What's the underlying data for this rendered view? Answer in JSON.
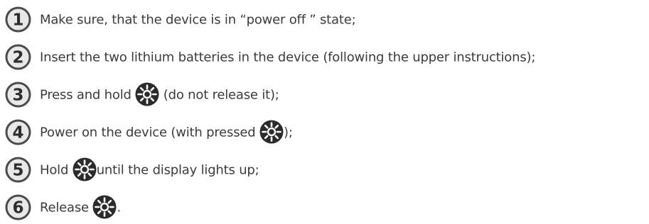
{
  "steps": [
    {
      "number": "1",
      "parts": [
        "Make sure, that the device is in “power off ” state;"
      ]
    },
    {
      "number": "2",
      "parts": [
        "Insert the two lithium batteries in the device (following the upper instructions);"
      ]
    },
    {
      "number": "3",
      "parts": [
        "Press and hold ",
        " (do not release it);"
      ]
    },
    {
      "number": "4",
      "parts": [
        "Power on the device (with pressed ",
        ");"
      ]
    },
    {
      "number": "5",
      "parts": [
        "Hold ",
        "until the display lights up;"
      ]
    },
    {
      "number": "6",
      "parts": [
        "Release ",
        "."
      ]
    }
  ],
  "icons": {
    "number_badge": "circled-number-icon",
    "button_icon": "sun-button-icon"
  },
  "colors": {
    "badge_border": "#4a4a4a",
    "badge_fill": "#e8e8e8",
    "text": "#3b3b3b",
    "icon_fill": "#2b2b2b",
    "icon_symbol": "#ffffff"
  }
}
